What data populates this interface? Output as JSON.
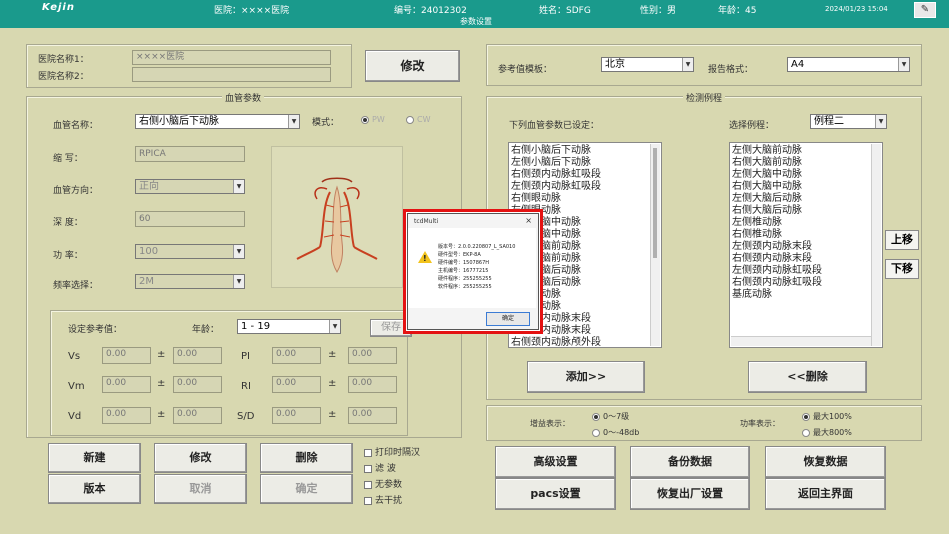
{
  "header": {
    "logo": "Kejin",
    "hospital": "医院：××××医院",
    "number": "编号：24012302",
    "name": "姓名：SDFG",
    "gender": "性别：男",
    "age": "年龄：45",
    "datetime": "2024/01/23   15:04",
    "title": "参数设置",
    "brush_icon": "✎"
  },
  "hospital_panel": {
    "label1": "医院名称1：",
    "value1": "××××医院",
    "label2": "医院名称2：",
    "value2": "",
    "modify_button": "修改"
  },
  "reference_panel": {
    "template_label": "参考值模板：",
    "template_value": "北京",
    "report_label": "报告格式：",
    "report_value": "A4"
  },
  "vessel_params": {
    "legend": "血管参数",
    "vessel_name_label": "血管名称：",
    "vessel_name_value": "右侧小脑后下动脉",
    "mode_label": "模式：",
    "mode_pw": "PW",
    "mode_cw": "CW",
    "abbr_label": "缩      写：",
    "abbr_value": "RPICA",
    "direction_label": "血管方向：",
    "direction_value": "正向",
    "depth_label": "深      度：",
    "depth_value": "60",
    "power_label": "功      率：",
    "power_value": "100",
    "freq_label": "频率选择：",
    "freq_value": "2M"
  },
  "ref_values": {
    "label": "设定参考值：",
    "age_label": "年龄：",
    "age_value": "1 - 19",
    "save_button": "保存",
    "rows": [
      {
        "l1": "Vs",
        "v1": "0.00",
        "v2": "0.00",
        "l2": "PI",
        "v3": "0.00",
        "v4": "0.00"
      },
      {
        "l1": "Vm",
        "v1": "0.00",
        "v2": "0.00",
        "l2": "RI",
        "v3": "0.00",
        "v4": "0.00"
      },
      {
        "l1": "Vd",
        "v1": "0.00",
        "v2": "0.00",
        "l2": "S/D",
        "v3": "0.00",
        "v4": "0.00"
      }
    ],
    "pm": "±"
  },
  "actions_left": {
    "new": "新建",
    "modify": "修改",
    "delete": "删除",
    "version": "版本",
    "cancel": "取消",
    "confirm": "确定"
  },
  "checkboxes": [
    "打印时隔汉",
    "滤      波",
    "无参数",
    "去干扰"
  ],
  "detection": {
    "legend": "检测例程",
    "set_label": "下列血管参数已设定：",
    "choose_label": "选择例程：",
    "choose_value": "例程二",
    "set_list": [
      "右侧小脑后下动脉",
      "左侧小脑后下动脉",
      "右侧颈内动脉虹吸段",
      "左侧颈内动脉虹吸段",
      "右侧眼动脉",
      "左侧眼动脉",
      "右侧大脑中动脉",
      "左侧大脑中动脉",
      "右侧大脑前动脉",
      "左侧大脑前动脉",
      "右侧大脑后动脉",
      "左侧大脑后动脉",
      "右侧椎动脉",
      "左侧椎动脉",
      "右侧颈内动脉末段",
      "左侧颈内动脉末段",
      "右侧颈内动脉颅外段"
    ],
    "routine_list": [
      "左侧大脑前动脉",
      "右侧大脑前动脉",
      "左侧大脑中动脉",
      "右侧大脑中动脉",
      "左侧大脑后动脉",
      "右侧大脑后动脉",
      "左侧椎动脉",
      "右侧椎动脉",
      "左侧颈内动脉末段",
      "右侧颈内动脉末段",
      "左侧颈内动脉虹吸段",
      "右侧颈内动脉虹吸段",
      "基底动脉"
    ],
    "up_button": "上移",
    "down_button": "下移",
    "add_button": "添加>>",
    "remove_button": "<<删除"
  },
  "display": {
    "gain_label": "增益表示：",
    "gain_opt1": "0～7级",
    "gain_opt2": "0～-48db",
    "power_label": "功率表示：",
    "power_opt1": "最大100%",
    "power_opt2": "最大800%"
  },
  "actions_right": {
    "advanced": "高级设置",
    "backup": "备份数据",
    "restore": "恢复数据",
    "pacs": "pacs设置",
    "factory": "恢复出厂设置",
    "back": "返回主界面"
  },
  "dialog": {
    "title": "tcdMulti",
    "close": "×",
    "lines": [
      "版本号：2.0.0.220807_L_SA010",
      "硬件型号：EKP-8A",
      "硬件编号：1507867H",
      "主机编号：16777215",
      "硬件程序：255255255",
      "软件程序：255255255"
    ],
    "ok": "确定"
  }
}
